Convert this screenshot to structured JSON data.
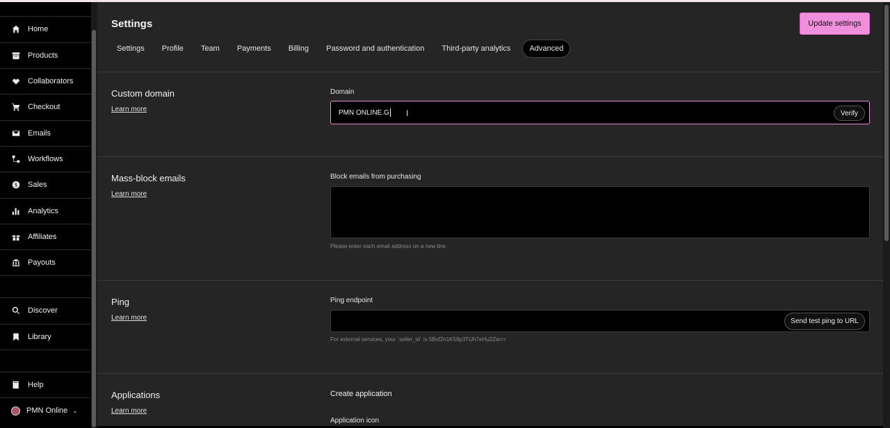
{
  "sidebar": {
    "items": [
      {
        "label": "Home",
        "icon": "home-icon"
      },
      {
        "label": "Products",
        "icon": "archive-icon"
      },
      {
        "label": "Collaborators",
        "icon": "handshake-icon"
      },
      {
        "label": "Checkout",
        "icon": "cart-icon"
      },
      {
        "label": "Emails",
        "icon": "envelope-icon"
      },
      {
        "label": "Workflows",
        "icon": "workflow-icon"
      },
      {
        "label": "Sales",
        "icon": "dollar-icon"
      },
      {
        "label": "Analytics",
        "icon": "bar-chart-icon"
      },
      {
        "label": "Affiliates",
        "icon": "gift-icon"
      },
      {
        "label": "Payouts",
        "icon": "bank-icon"
      }
    ],
    "secondary": [
      {
        "label": "Discover",
        "icon": "search-icon"
      },
      {
        "label": "Library",
        "icon": "bookmark-icon"
      }
    ],
    "help": {
      "label": "Help",
      "icon": "book-icon"
    },
    "account": {
      "label": "PMN Online"
    }
  },
  "header": {
    "title": "Settings",
    "update_button": "Update settings",
    "tabs": [
      "Settings",
      "Profile",
      "Team",
      "Payments",
      "Billing",
      "Password and authentication",
      "Third-party analytics",
      "Advanced"
    ],
    "active_tab": "Advanced"
  },
  "sections": {
    "custom_domain": {
      "title": "Custom domain",
      "learn_more": "Learn more",
      "field_label": "Domain",
      "value": "PMN ONLINE.G",
      "verify": "Verify"
    },
    "mass_block": {
      "title": "Mass-block emails",
      "learn_more": "Learn more",
      "field_label": "Block emails from purchasing",
      "help": "Please enter each email address on a new line."
    },
    "ping": {
      "title": "Ping",
      "learn_more": "Learn more",
      "field_label": "Ping endpoint",
      "button": "Send test ping to URL",
      "help": "For external services, your `seller_id` is 5Bxf2n1K59p3TUh7eHu2Zw=="
    },
    "applications": {
      "title": "Applications",
      "learn_more": "Learn more",
      "create": "Create application",
      "icon_label": "Application icon"
    }
  },
  "colors": {
    "accent": "#f08fdc",
    "background": "#252525",
    "sidebar": "#000000"
  }
}
